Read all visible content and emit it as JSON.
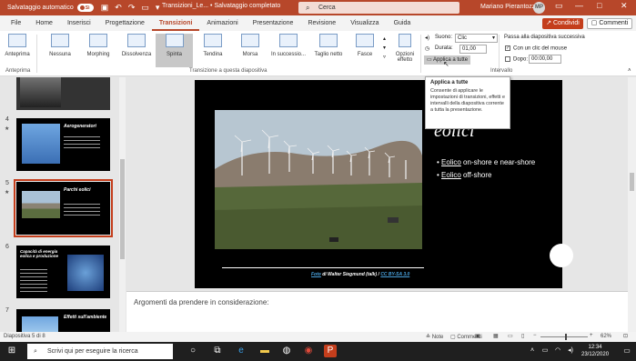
{
  "titlebar": {
    "autosave": "Salvataggio automatico",
    "toggle_state": "Sì",
    "document": "Transizioni_Le...  •  Salvataggio completato",
    "search_placeholder": "Cerca",
    "user": "Mariano Pierantozzi",
    "avatar": "MP"
  },
  "tabs": [
    "File",
    "Home",
    "Inserisci",
    "Progettazione",
    "Transizioni",
    "Animazioni",
    "Presentazione",
    "Revisione",
    "Visualizza",
    "Guida"
  ],
  "active_tab": "Transizioni",
  "share": "Condividi",
  "comments": "Commenti",
  "ribbon": {
    "preview": "Anteprima",
    "preview_group": "Anteprima",
    "transitions": [
      "Nessuna",
      "Morphing",
      "Dissolvenza",
      "Spinta",
      "Tendina",
      "Morsa",
      "In successio...",
      "Taglio netto",
      "Fasce"
    ],
    "selected_transition": "Spinta",
    "effect_options": "Opzioni effetto",
    "group_label": "Transizione a questa diapositiva",
    "sound_label": "Suono:",
    "sound_value": "Clic",
    "duration_label": "Durata:",
    "duration_value": "01,00",
    "apply_all": "Applica a tutte",
    "advance_label": "Passa alla diapositiva successiva",
    "on_click": "Con un clic del mouse",
    "after": "Dopo:",
    "after_value": "00:00,00",
    "timing_group": "Intervallo"
  },
  "tooltip": {
    "title": "Applica a tutte",
    "description": "Consente di applicare le impostazioni di transizioni, effetti e intervalli della diapositiva corrente a tutta la presentazione."
  },
  "thumbnails": [
    {
      "num": "",
      "title": ""
    },
    {
      "num": "4",
      "title": "Aerogeneratori"
    },
    {
      "num": "5",
      "title": "Parchi eolici"
    },
    {
      "num": "6",
      "title": "Capacità di energia eolica e produzione"
    },
    {
      "num": "7",
      "title": "Effetti sull'ambiente"
    }
  ],
  "slide": {
    "title": "eolici",
    "bullets": [
      {
        "link": "Eolico",
        "rest": " on-shore e near-shore"
      },
      {
        "link": "Eolico",
        "rest": " off-shore"
      }
    ],
    "caption_link1": "Foto",
    "caption_mid": " di Walter Siegmund (talk) / ",
    "caption_link2": "CC BY-SA 3.0"
  },
  "notes": "Argomenti da prendere in considerazione:",
  "status": {
    "slide_count": "Diapositiva 5 di 8",
    "notes_btn": "Note",
    "comments_btn": "Commenti",
    "zoom": "62%"
  },
  "taskbar": {
    "search": "Scrivi qui per eseguire la ricerca",
    "time": "12:34",
    "date": "23/12/2020"
  }
}
